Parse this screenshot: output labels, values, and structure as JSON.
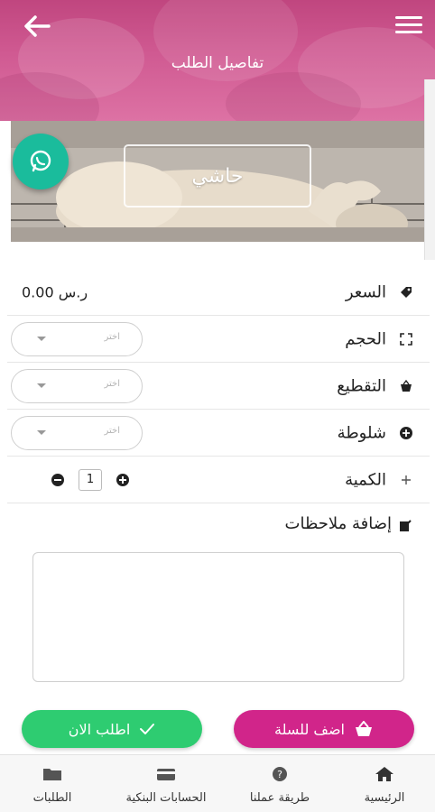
{
  "header": {
    "title": "تفاصيل الطلب",
    "back_icon": "back-arrow-icon",
    "menu_icon": "hamburger-menu-icon"
  },
  "banner": {
    "label": "حاشي"
  },
  "whatsapp": {
    "icon": "whatsapp-icon",
    "color": "#1abc9c"
  },
  "details": {
    "price_label": "السعر",
    "price_value": "0.00 ر.س",
    "size_label": "الحجم",
    "size_placeholder": "اختر",
    "cutting_label": "التقطيع",
    "cutting_placeholder": "اختر",
    "stuffing_label": "شلوطة",
    "stuffing_placeholder": "اختر",
    "quantity_label": "الكمية",
    "quantity_value": "1",
    "notes_label": "إضافة ملاحظات"
  },
  "actions": {
    "order_now": "اطلب الان",
    "add_to_cart": "اضف للسلة",
    "order_color": "#2ecc71",
    "cart_color": "#d1258a"
  },
  "nav": {
    "home": "الرئيسية",
    "how_we_work": "طريقة عملنا",
    "bank_accounts": "الحسابات البنكية",
    "orders": "الطلبات"
  },
  "colors": {
    "brand_pink": "#d1258a",
    "header_pink": "#c0467f"
  }
}
